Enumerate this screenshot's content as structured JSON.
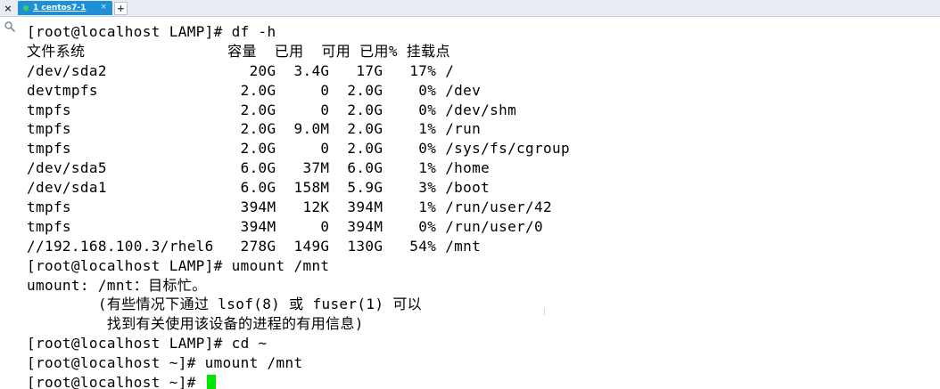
{
  "tab": {
    "close_all": "×",
    "label": "1 centos7-1",
    "close": "×",
    "add": "+",
    "status_color": "#39d353",
    "accent": "#1e90d6"
  },
  "terminal": {
    "cursor_color": "#00e600",
    "lines": [
      "[root@localhost LAMP]# df -h",
      "文件系统                容量  已用  可用 已用% 挂载点",
      "/dev/sda2                20G  3.4G   17G   17% /",
      "devtmpfs                2.0G     0  2.0G    0% /dev",
      "tmpfs                   2.0G     0  2.0G    0% /dev/shm",
      "tmpfs                   2.0G  9.0M  2.0G    1% /run",
      "tmpfs                   2.0G     0  2.0G    0% /sys/fs/cgroup",
      "/dev/sda5               6.0G   37M  6.0G    1% /home",
      "/dev/sda1               6.0G  158M  5.9G    3% /boot",
      "tmpfs                   394M   12K  394M    1% /run/user/42",
      "tmpfs                   394M     0  394M    0% /run/user/0",
      "//192.168.100.3/rhel6   278G  149G  130G   54% /mnt",
      "[root@localhost LAMP]# umount /mnt",
      "umount: /mnt：目标忙。",
      "        (有些情况下通过 lsof(8) 或 fuser(1) 可以",
      "         找到有关使用该设备的进程的有用信息)",
      "[root@localhost LAMP]# cd ~",
      "[root@localhost ~]# umount /mnt",
      "[root@localhost ~]# "
    ]
  }
}
